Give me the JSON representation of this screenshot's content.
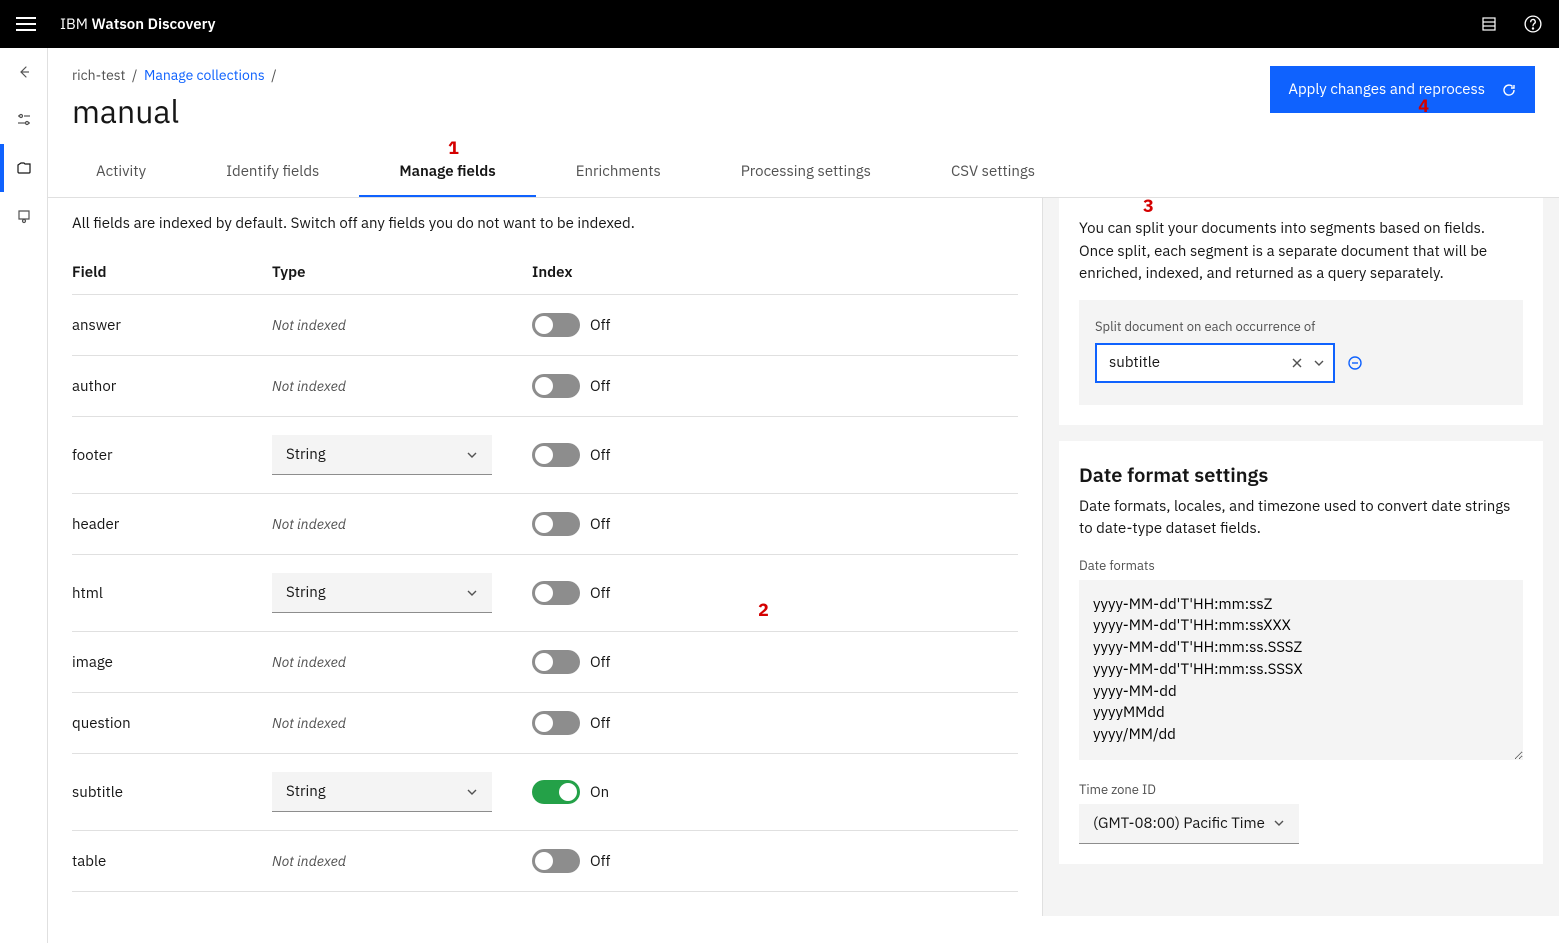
{
  "brand_prefix": "IBM ",
  "brand_bold": "Watson Discovery",
  "breadcrumb": {
    "project": "rich-test",
    "link": "Manage collections"
  },
  "page_title": "manual",
  "apply_label": "Apply changes and reprocess",
  "tabs": {
    "activity": "Activity",
    "identify": "Identify fields",
    "manage": "Manage fields",
    "enrich": "Enrichments",
    "processing": "Processing settings",
    "csv": "CSV settings"
  },
  "hint": "All fields are indexed by default. Switch off any fields you do not want to be indexed.",
  "cols": {
    "field": "Field",
    "type": "Type",
    "index": "Index"
  },
  "type_option": "String",
  "not_indexed": "Not indexed",
  "toggle_on": "On",
  "toggle_off": "Off",
  "fields": [
    {
      "name": "answer",
      "type": null,
      "on": false
    },
    {
      "name": "author",
      "type": null,
      "on": false
    },
    {
      "name": "footer",
      "type": "String",
      "on": false
    },
    {
      "name": "header",
      "type": null,
      "on": false
    },
    {
      "name": "html",
      "type": "String",
      "on": false
    },
    {
      "name": "image",
      "type": null,
      "on": false
    },
    {
      "name": "question",
      "type": null,
      "on": false
    },
    {
      "name": "subtitle",
      "type": "String",
      "on": true
    },
    {
      "name": "table",
      "type": null,
      "on": false
    }
  ],
  "split": {
    "desc": "You can split your documents into segments based on fields. Once split, each segment is a separate document that will be enriched, indexed, and returned as a query separately.",
    "label": "Split document on each occurrence of",
    "value": "subtitle"
  },
  "date": {
    "title": "Date format settings",
    "desc": "Date formats, locales, and timezone used to convert date strings to date-type dataset fields.",
    "formats_label": "Date formats",
    "formats": "yyyy-MM-dd'T'HH:mm:ssZ\nyyyy-MM-dd'T'HH:mm:ssXXX\nyyyy-MM-dd'T'HH:mm:ss.SSSZ\nyyyy-MM-dd'T'HH:mm:ss.SSSX\nyyyy-MM-dd\nyyyyMMdd\nyyyy/MM/dd",
    "tz_label": "Time zone ID",
    "tz_value": "(GMT-08:00) Pacific Time"
  },
  "annotations": {
    "a1": "1",
    "a2": "2",
    "a3": "3",
    "a4": "4"
  }
}
